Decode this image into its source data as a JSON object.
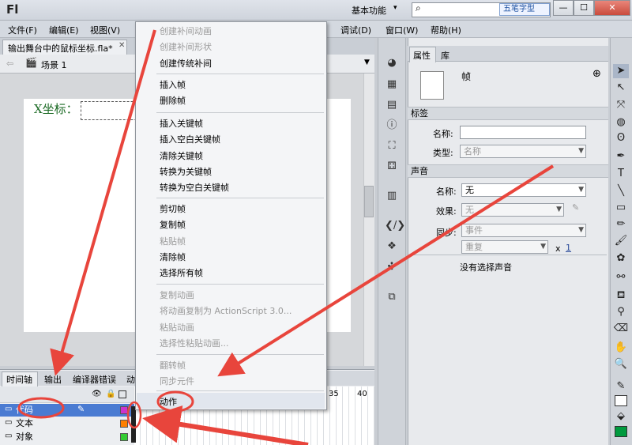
{
  "app": {
    "logo": "Fl",
    "workspace": "基本功能",
    "watermark": "五笔字型"
  },
  "window_controls": [
    "—",
    "☐",
    "✕"
  ],
  "menu": [
    "文件(F)",
    "编辑(E)",
    "视图(V)",
    "调试(D)",
    "窗口(W)",
    "帮助(H)"
  ],
  "document_tab": "输出舞台中的鼠标坐标.fla*",
  "scene": "场景 1",
  "stage": {
    "x_label": "X坐标："
  },
  "timeline": {
    "tabs": [
      "时间轴",
      "输出",
      "编译器错误",
      "动"
    ],
    "frame_numbers": [
      "35",
      "40"
    ],
    "layers": [
      {
        "name": "代码",
        "color": "#cc33cc",
        "selected": true
      },
      {
        "name": "文本",
        "color": "#ff7f00",
        "selected": false
      },
      {
        "name": "对象",
        "color": "#33cc33",
        "selected": false
      }
    ]
  },
  "context_menu": {
    "groups": [
      [
        {
          "label": "创建补间动画",
          "enabled": false
        },
        {
          "label": "创建补间形状",
          "enabled": false
        },
        {
          "label": "创建传统补间",
          "enabled": true
        }
      ],
      [
        {
          "label": "插入帧",
          "enabled": true
        },
        {
          "label": "删除帧",
          "enabled": true
        }
      ],
      [
        {
          "label": "插入关键帧",
          "enabled": true
        },
        {
          "label": "插入空白关键帧",
          "enabled": true
        },
        {
          "label": "清除关键帧",
          "enabled": true
        },
        {
          "label": "转换为关键帧",
          "enabled": true
        },
        {
          "label": "转换为空白关键帧",
          "enabled": true
        }
      ],
      [
        {
          "label": "剪切帧",
          "enabled": true
        },
        {
          "label": "复制帧",
          "enabled": true
        },
        {
          "label": "粘贴帧",
          "enabled": false
        },
        {
          "label": "清除帧",
          "enabled": true
        },
        {
          "label": "选择所有帧",
          "enabled": true
        }
      ],
      [
        {
          "label": "复制动画",
          "enabled": false
        },
        {
          "label": "将动画复制为 ActionScript 3.0...",
          "enabled": false
        },
        {
          "label": "粘贴动画",
          "enabled": false
        },
        {
          "label": "选择性粘贴动画...",
          "enabled": false
        }
      ],
      [
        {
          "label": "翻转帧",
          "enabled": false
        },
        {
          "label": "同步元件",
          "enabled": false
        }
      ],
      [
        {
          "label": "动作",
          "enabled": true
        }
      ]
    ]
  },
  "properties": {
    "tabs": [
      "属性",
      "库"
    ],
    "type_label": "帧",
    "label_section": "标签",
    "name_label": "名称:",
    "name_value": "",
    "type_field_label": "类型:",
    "type_value": "名称",
    "sound_section": "声音",
    "sound_name_label": "名称:",
    "sound_name_value": "无",
    "effect_label": "效果:",
    "effect_value": "无",
    "sync_label": "同步:",
    "sync_value": "事件",
    "repeat_value": "重复",
    "repeat_x": "x",
    "repeat_count": "1",
    "no_sound": "没有选择声音"
  },
  "colors": {
    "annotation_red": "#e8453c",
    "stage_text": "#1b6a24",
    "fill_swatch": "#009a3e"
  }
}
